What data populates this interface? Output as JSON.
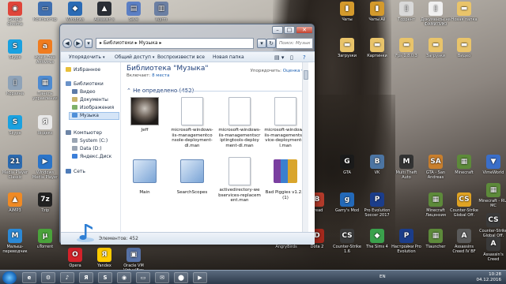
{
  "desktop": {
    "icons": [
      {
        "label": "Google Chrome",
        "color": "#e0453a",
        "glyph": "◉"
      },
      {
        "label": "Компьютер",
        "color": "#3f6fb0",
        "glyph": "▭"
      },
      {
        "label": "Windows",
        "color": "#2a6bb5",
        "glyph": "◆"
      },
      {
        "label": "Assassin's",
        "color": "#2b2f36",
        "glyph": "▲"
      },
      {
        "label": "Save",
        "color": "#5b7fc4",
        "glyph": "▤"
      },
      {
        "label": "Wyrm",
        "color": "#6b7fa3",
        "glyph": "▥"
      },
      {
        "label": "Skype",
        "color": "#1aa1e0",
        "glyph": "S"
      },
      {
        "label": "Avast Free Antivirus",
        "color": "#f07c1f",
        "glyph": "a"
      },
      {
        "label": "Корзина",
        "color": "#8fa3b8",
        "glyph": "▯"
      },
      {
        "label": "Панель управления",
        "color": "#4e8bd1",
        "glyph": "▦"
      },
      {
        "label": "Skype",
        "color": "#1aa1e0",
        "glyph": "S"
      },
      {
        "label": "Яндекс",
        "color": "#e8e8e8",
        "glyph": "Я"
      },
      {
        "label": "Media Player Classic",
        "color": "#2b6ab0",
        "glyph": "21"
      },
      {
        "label": "Windows Media Player",
        "color": "#2a74c9",
        "glyph": "▶"
      },
      {
        "label": "AIMP3",
        "color": "#f08a24",
        "glyph": "▲"
      },
      {
        "label": "7zip",
        "color": "#222222",
        "glyph": "7z"
      },
      {
        "label": "Малыш-переводчик",
        "color": "#2b89d6",
        "glyph": "M"
      },
      {
        "label": "uTorrent",
        "color": "#4aa33b",
        "glyph": "µ"
      },
      {
        "label": "Opera",
        "color": "#d4222a",
        "glyph": "O"
      },
      {
        "label": "Yandex",
        "color": "#ffcc00",
        "glyph": "Я"
      },
      {
        "label": "Oracle VM VirtualBox",
        "color": "#5772a6",
        "glyph": "▣"
      },
      {
        "label": "Чаты",
        "color": "#d49a2c",
        "glyph": "▮"
      },
      {
        "label": "Чаты All",
        "color": "#d49a2c",
        "glyph": "▮"
      },
      {
        "label": "Торрент",
        "color": "#d9d9d9",
        "glyph": "▯"
      },
      {
        "label": "Документы на ФАМИЛИЮ",
        "color": "#f0f0f0",
        "glyph": "▯"
      },
      {
        "label": "Новая папка",
        "color": "#e9c46a",
        "glyph": "▬"
      },
      {
        "label": "Загрузки",
        "color": "#e9c46a",
        "glyph": "▬"
      },
      {
        "label": "Картинки",
        "color": "#e9c46a",
        "glyph": "▬"
      },
      {
        "label": "Fps 1.8.0.3",
        "color": "#e9c46a",
        "glyph": "▬"
      },
      {
        "label": "Загрузки",
        "color": "#e9c46a",
        "glyph": "▬"
      },
      {
        "label": "Видео",
        "color": "#e9c46a",
        "glyph": "▬"
      },
      {
        "label": "GTA",
        "color": "#1a1a1a",
        "glyph": "G"
      },
      {
        "label": "VK",
        "color": "#4c75a3",
        "glyph": "B"
      },
      {
        "label": "Multi Theft Auto",
        "color": "#333333",
        "glyph": "M"
      },
      {
        "label": "GTA - San Andreas",
        "color": "#c97f2d",
        "glyph": "SA"
      },
      {
        "label": "Minecraft",
        "color": "#5d8a3a",
        "glyph": "▦"
      },
      {
        "label": "VimeWorld",
        "color": "#3a6ec9",
        "glyph": "▼"
      },
      {
        "label": "Minecraft - RU-MC",
        "color": "#5d8a3a",
        "glyph": "▦"
      },
      {
        "label": "Bread",
        "color": "#b23a2a",
        "glyph": "B"
      },
      {
        "label": "Garry's Mod",
        "color": "#2369b8",
        "glyph": "g"
      },
      {
        "label": "Pro Evolution Soccer 2017",
        "color": "#1b3d8a",
        "glyph": "P"
      },
      {
        "label": "Minecraft Лицензия",
        "color": "#5d8a3a",
        "glyph": "▦"
      },
      {
        "label": "Counter-Strike Global Off.",
        "color": "#e0a323",
        "glyph": "CS"
      },
      {
        "label": "Counter-Strike Global Off.",
        "color": "#3a3a3a",
        "glyph": "CS"
      },
      {
        "label": "AngryBirds",
        "color": "#c1272d",
        "glyph": "●"
      },
      {
        "label": "Dota 2",
        "color": "#a3281c",
        "glyph": "D"
      },
      {
        "label": "Counter-Strike 1.6",
        "color": "#3b3b3b",
        "glyph": "CS"
      },
      {
        "label": "The Sims 4",
        "color": "#3aa14c",
        "glyph": "◆"
      },
      {
        "label": "Настройки Pro Evolution",
        "color": "#1b3d8a",
        "glyph": "P"
      },
      {
        "label": "Tlauncher",
        "color": "#5d8a3a",
        "glyph": "▦"
      },
      {
        "label": "Assassins Creed IV BF",
        "color": "#5a5a5a",
        "glyph": "A"
      },
      {
        "label": "Assassin's Creed",
        "color": "#3a3a3a",
        "glyph": "A"
      }
    ]
  },
  "explorer": {
    "address": "▸ Библиотеки ▸ Музыка ▸",
    "search_placeholder": "Поиск: Музык",
    "toolbar": {
      "organize": "Упорядочить",
      "share": "Общий доступ",
      "play_all": "Воспроизвести все",
      "new_folder": "Новая папка"
    },
    "nav": {
      "favorites": "Избранное",
      "libraries": "Библиотеки",
      "video": "Видео",
      "documents": "Документы",
      "images": "Изображения",
      "music": "Музыка",
      "computer": "Компьютер",
      "system_c": "System (C:)",
      "data_d": "Data (D:)",
      "yandex_disk": "Яндекс.Диск",
      "network": "Сеть"
    },
    "library": {
      "title": "Библиотека \"Музыка\"",
      "includes_label": "Включает:",
      "includes_link": "8 места",
      "arrange_label": "Упорядочить:",
      "arrange_value": "Оценка",
      "group_header": "Не определено (452)"
    },
    "files": [
      {
        "name": "Jeff",
        "kind": "photo"
      },
      {
        "name": "microsoft-windows-iis-managementconsole-deployment-dl.man",
        "kind": "doc"
      },
      {
        "name": "microsoft-windows-iis-managementscriptingtools-deployment-dl.man",
        "kind": "doc"
      },
      {
        "name": "microsoft-windows-iis-managementservice-deployment-dl.man",
        "kind": "doc"
      },
      {
        "name": "Main",
        "kind": "app"
      },
      {
        "name": "SearchScopes",
        "kind": "app"
      },
      {
        "name": "activedirectory-webservices-replacement.man",
        "kind": "doc"
      },
      {
        "name": "Bad Piggies v1.2.0 (1)",
        "kind": "rar"
      }
    ],
    "status": "Элементов: 452"
  },
  "taskbar": {
    "apps": [
      "e",
      "⚙",
      "♪",
      "Я",
      "S",
      "◉",
      "▭",
      "✉",
      "⬤",
      "▶"
    ],
    "language": "EN",
    "time": "10:28",
    "date": "04.12.2016"
  }
}
